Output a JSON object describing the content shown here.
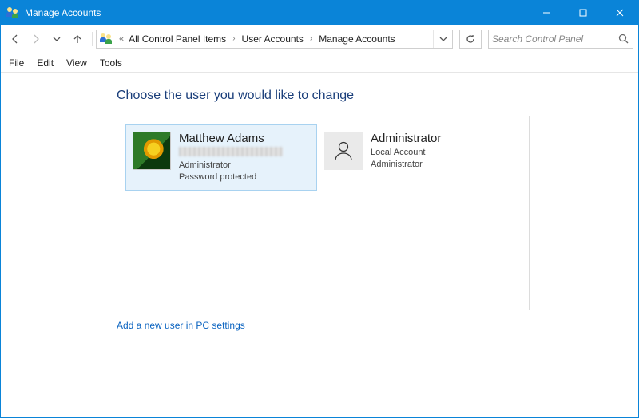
{
  "window": {
    "title": "Manage Accounts"
  },
  "breadcrumb": {
    "items": [
      {
        "label": "All Control Panel Items"
      },
      {
        "label": "User Accounts"
      },
      {
        "label": "Manage Accounts"
      }
    ]
  },
  "search": {
    "placeholder": "Search Control Panel"
  },
  "menubar": {
    "items": [
      {
        "label": "File"
      },
      {
        "label": "Edit"
      },
      {
        "label": "View"
      },
      {
        "label": "Tools"
      }
    ]
  },
  "page": {
    "heading": "Choose the user you would like to change",
    "add_link": "Add a new user in PC settings"
  },
  "accounts": [
    {
      "name": "Matthew Adams",
      "email_obscured": true,
      "role": "Administrator",
      "extra": "Password protected",
      "selected": true,
      "avatar": "photo"
    },
    {
      "name": "Administrator",
      "role_line1": "Local Account",
      "role_line2": "Administrator",
      "selected": false,
      "avatar": "placeholder"
    }
  ]
}
